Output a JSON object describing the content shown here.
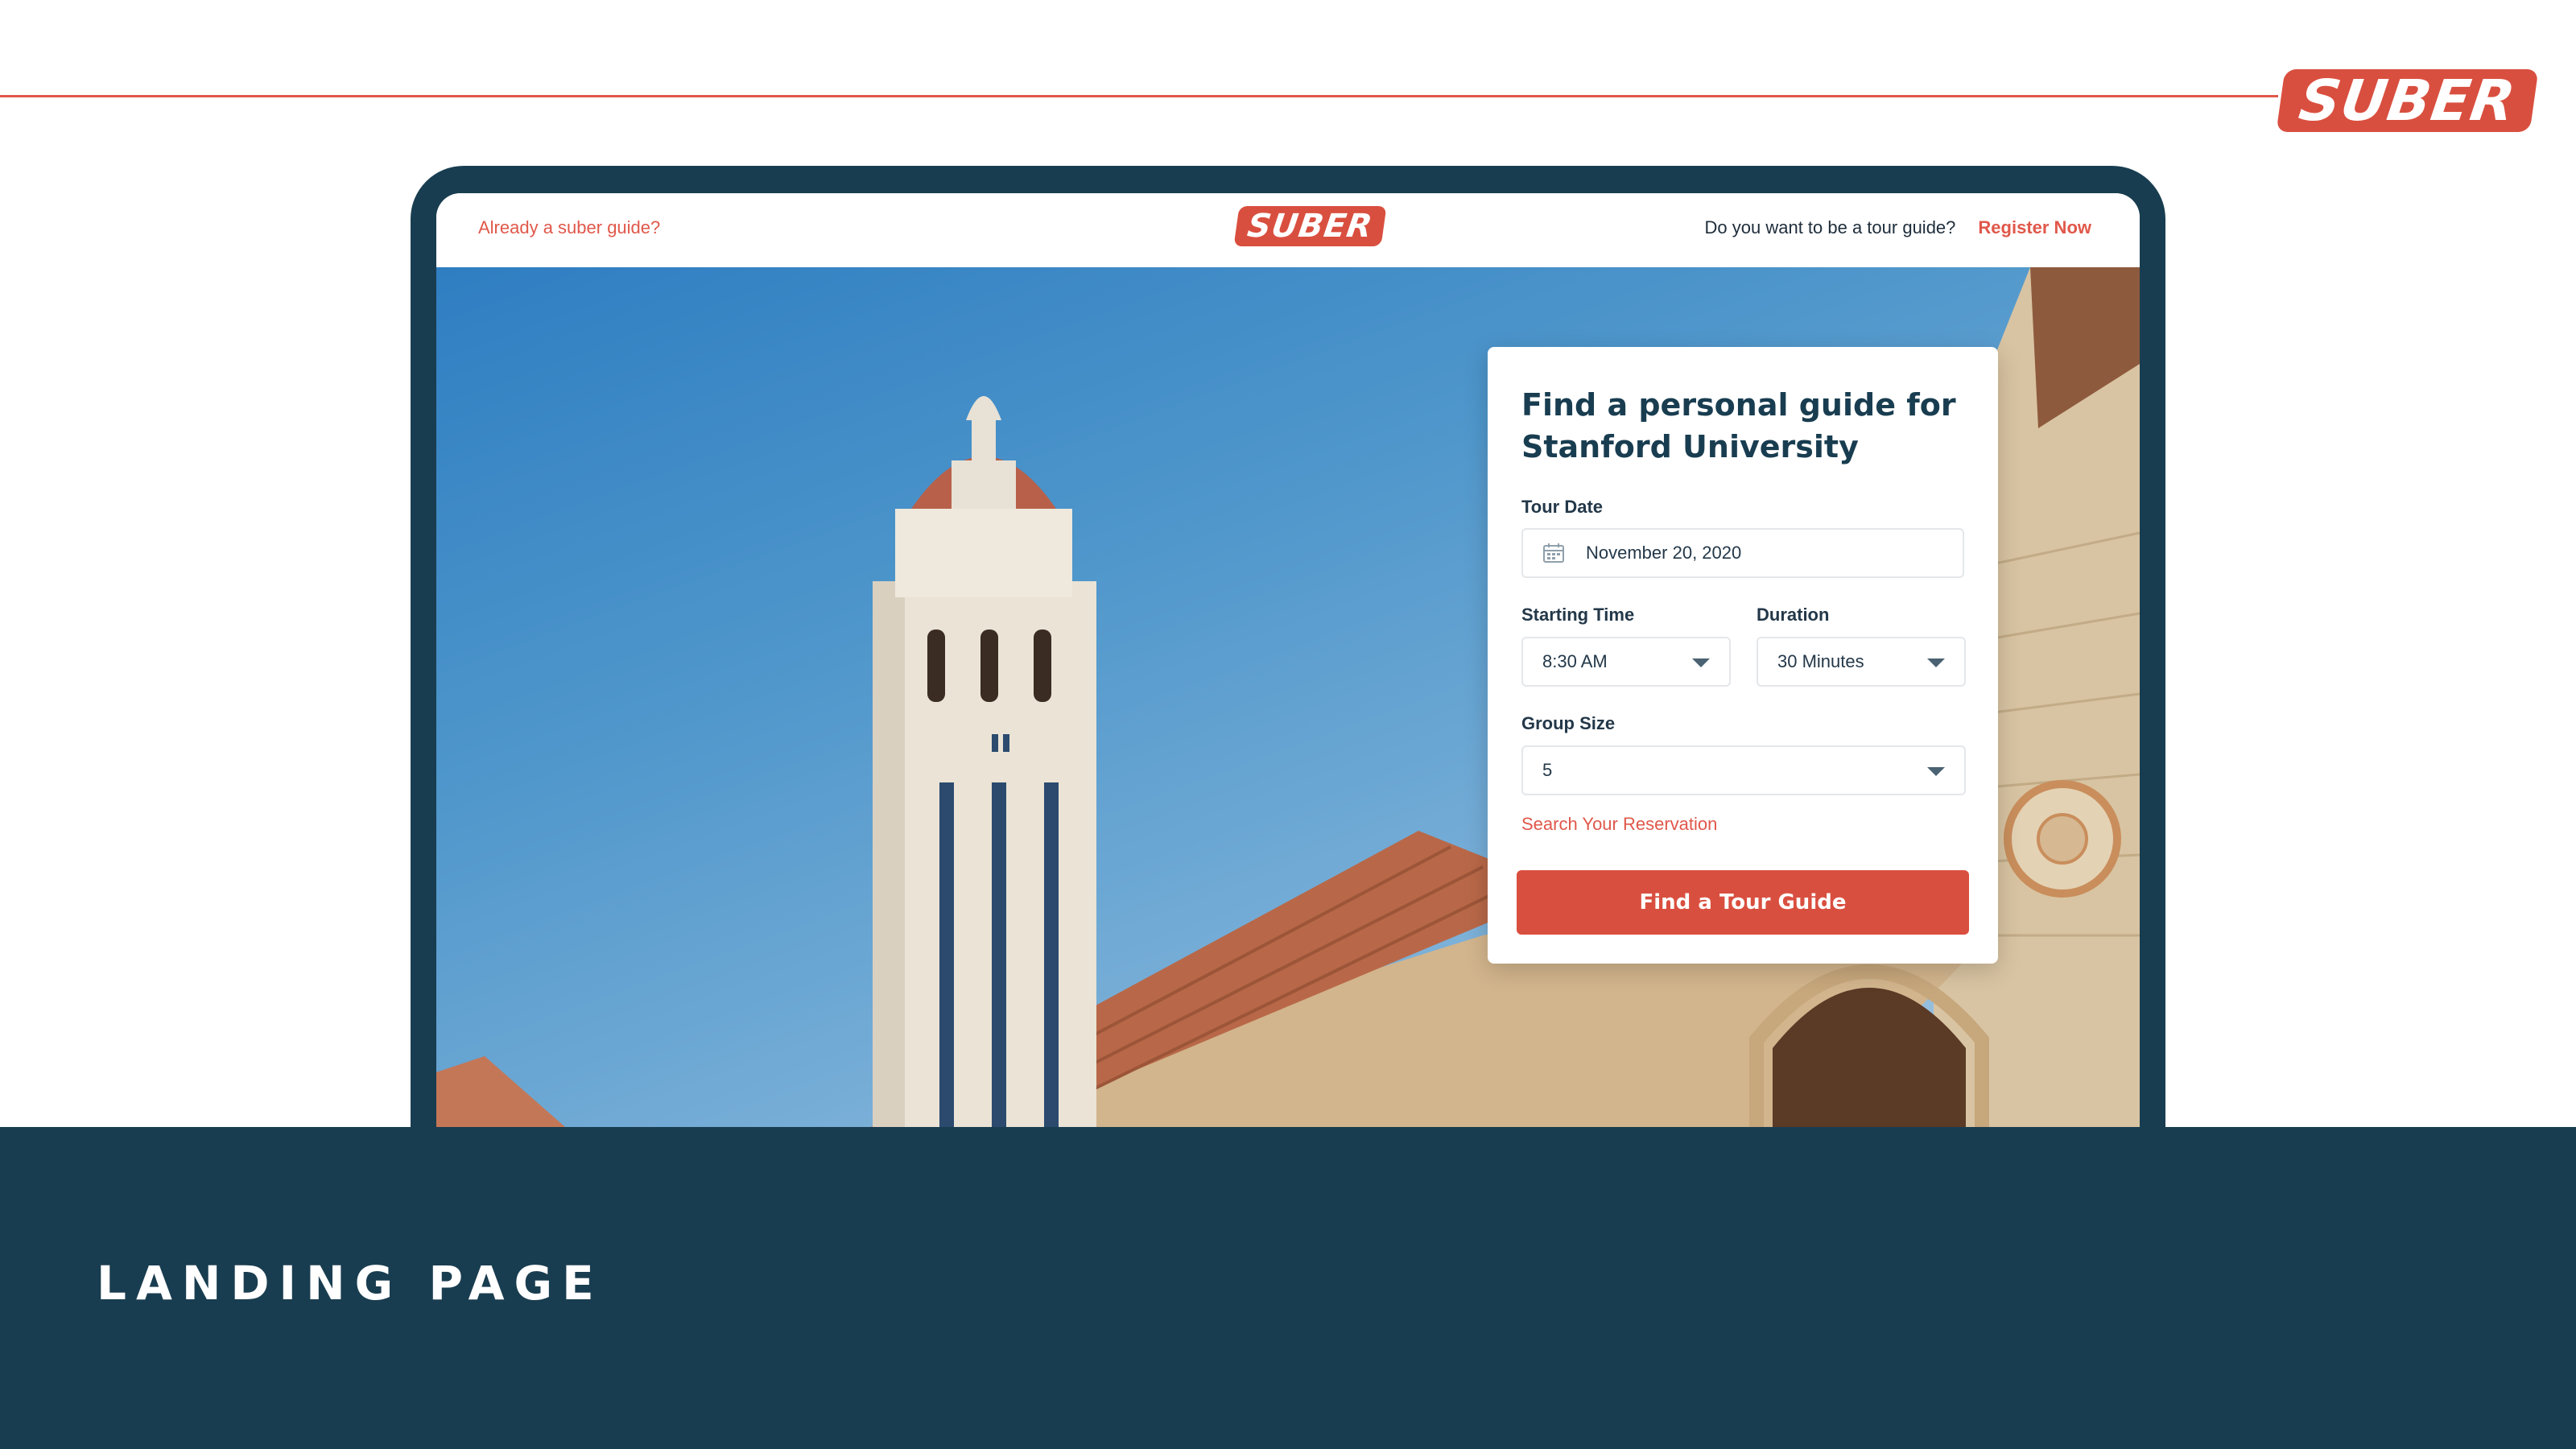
{
  "brand": {
    "logo_text": "SUBER"
  },
  "header": {
    "login_link": "Already a suber guide?",
    "question": "Do you want to be a tour guide?",
    "register_label": "Register Now"
  },
  "booking": {
    "title": "Find a personal guide for Stanford University",
    "tour_date_label": "Tour Date",
    "tour_date_value": "November 20, 2020",
    "start_label": "Starting Time",
    "start_value": "8:30 AM",
    "duration_label": "Duration",
    "duration_value": "30 Minutes",
    "group_label": "Group Size",
    "group_value": "5",
    "search_link": "Search Your Reservation",
    "cta_label": "Find a Tour Guide"
  },
  "section": {
    "label": "LANDING PAGE"
  },
  "colors": {
    "accent": "#d94f3f",
    "navy": "#193d50",
    "sky": "#4e96cb"
  },
  "icons": {
    "calendar": "calendar-icon",
    "dropdown": "chevron-down-icon"
  }
}
